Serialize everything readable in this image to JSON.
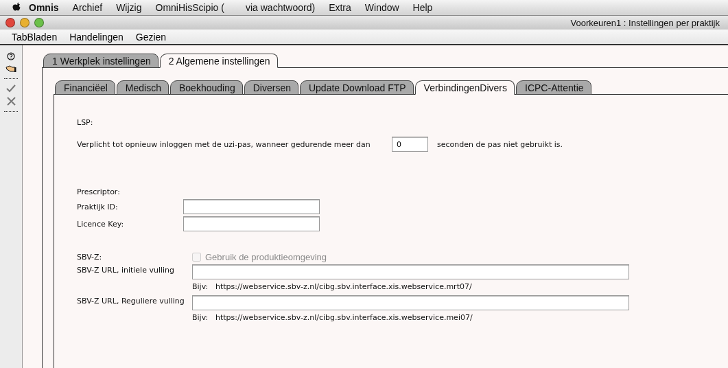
{
  "menubar": {
    "app": "Omnis",
    "items": [
      "Archief",
      "Wijzig",
      "OmniHisScipio (        via wachtwoord)",
      "Extra",
      "Window",
      "Help"
    ]
  },
  "window": {
    "title": "Voorkeuren1 : Instellingen per praktijk"
  },
  "app_menu": [
    "TabBladen",
    "Handelingen",
    "Gezien"
  ],
  "toolbar": [
    {
      "kind": "help"
    },
    {
      "kind": "hand"
    },
    {
      "kind": "divider"
    },
    {
      "kind": "check"
    },
    {
      "kind": "cross"
    },
    {
      "kind": "divider"
    }
  ],
  "tabs": [
    {
      "label": "1 Werkplek instellingen",
      "selected": false
    },
    {
      "label": "2 Algemene instellingen",
      "selected": true
    }
  ],
  "subtabs": [
    {
      "label": "Financiëel",
      "selected": false
    },
    {
      "label": "Medisch",
      "selected": false
    },
    {
      "label": "Boekhouding",
      "selected": false
    },
    {
      "label": "Diversen",
      "selected": false
    },
    {
      "label": "Update Download FTP",
      "selected": false
    },
    {
      "label": "VerbindingenDivers",
      "selected": true
    },
    {
      "label": "ICPC-Attentie",
      "selected": false
    }
  ],
  "lsp": {
    "heading": "LSP:",
    "before": "Verplicht tot opnieuw inloggen met de uzi-pas, wanneer gedurende meer dan",
    "value": "0",
    "after": "seconden de pas niet gebruikt is."
  },
  "prescriptor": {
    "heading": "Prescriptor:",
    "fields": [
      {
        "label": "Praktijk ID:"
      },
      {
        "label": "Licence Key:"
      }
    ]
  },
  "sbvz": {
    "heading": "SBV-Z:",
    "checkbox": {
      "label": "Gebruik de produktieomgeving",
      "checked": false,
      "disabled": true
    },
    "fields": [
      {
        "label": "SBV-Z URL, initiele vulling",
        "hint_label": "Bijv:",
        "hint": "https://webservice.sbv-z.nl/cibg.sbv.interface.xis.webservice.mrt07/"
      },
      {
        "label": "SBV-Z URL, Reguliere vulling",
        "hint_label": "Bijv:",
        "hint": "https://webservice.sbv-z.nl/cibg.sbv.interface.xis.webservice.mei07/"
      }
    ]
  }
}
